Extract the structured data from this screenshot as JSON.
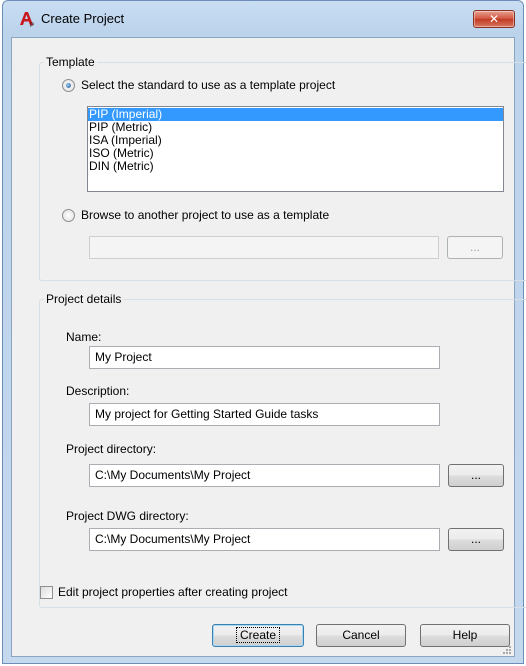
{
  "window": {
    "title": "Create Project",
    "close_label": "✕"
  },
  "template_group": {
    "legend": "Template",
    "standard_radio_label": "Select the standard to use as a template project",
    "standard_radio_checked": true,
    "standards": [
      {
        "label": "PIP (Imperial)",
        "selected": true
      },
      {
        "label": "PIP (Metric)",
        "selected": false
      },
      {
        "label": "ISA (Imperial)",
        "selected": false
      },
      {
        "label": "ISO (Metric)",
        "selected": false
      },
      {
        "label": "DIN (Metric)",
        "selected": false
      }
    ],
    "browse_radio_label": "Browse to another project to use as a template",
    "browse_radio_checked": false,
    "browse_path_value": "",
    "browse_button_label": "..."
  },
  "details_group": {
    "legend": "Project details",
    "name_label": "Name:",
    "name_value": "My Project",
    "description_label": "Description:",
    "description_value": "My project for Getting Started Guide tasks",
    "directory_label": "Project directory:",
    "directory_value": "C:\\My Documents\\My Project",
    "directory_browse_label": "...",
    "dwg_directory_label": "Project DWG directory:",
    "dwg_directory_value": "C:\\My Documents\\My Project",
    "dwg_browse_label": "..."
  },
  "edit_properties_checkbox": {
    "label": "Edit project properties after creating project",
    "checked": false
  },
  "buttons": {
    "create": "Create",
    "cancel": "Cancel",
    "help": "Help"
  }
}
